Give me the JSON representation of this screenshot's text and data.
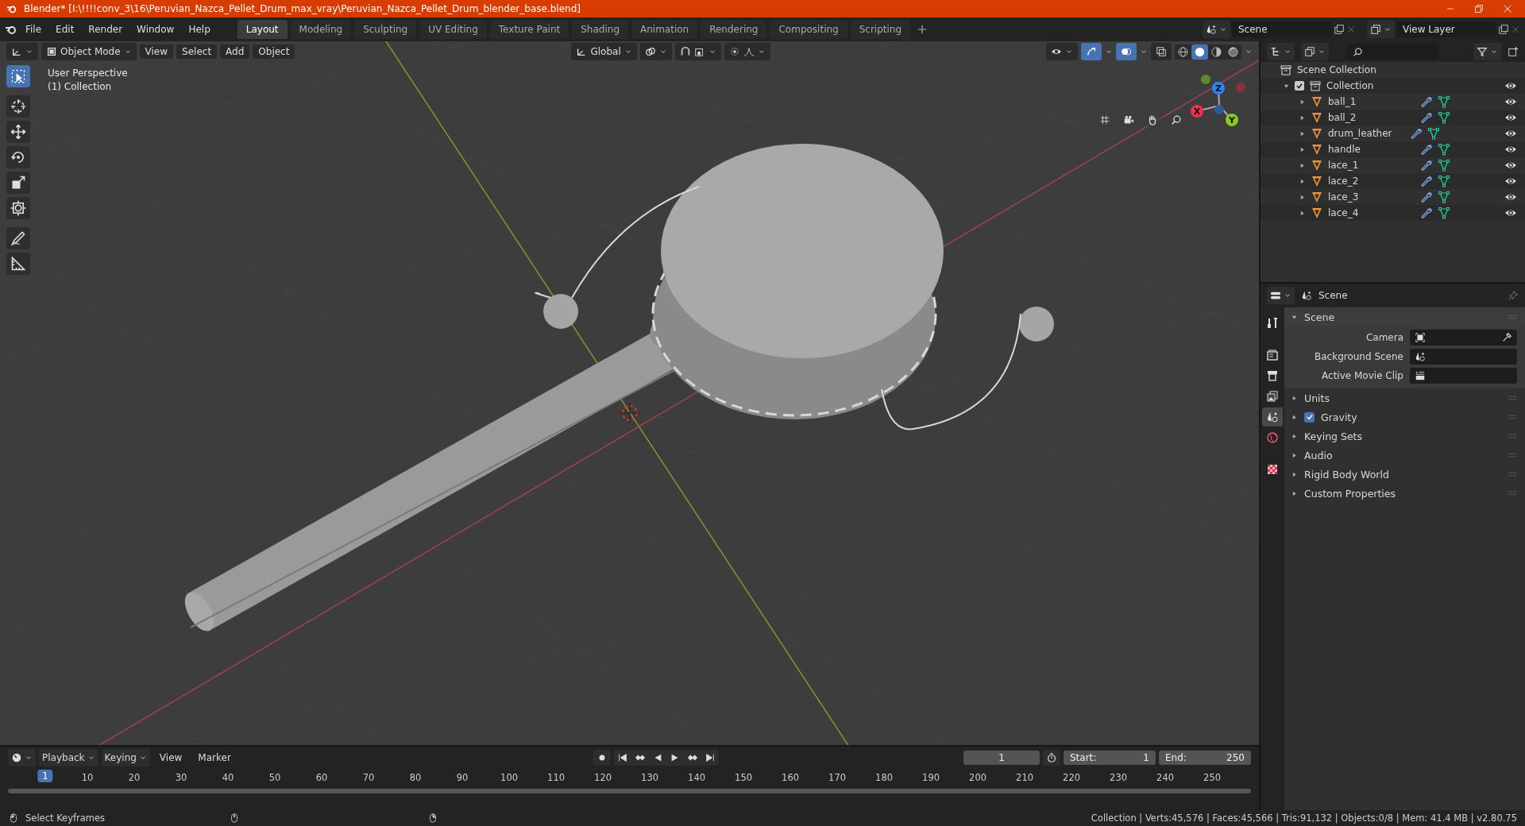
{
  "window": {
    "title": "Blender* [I:\\!!!!conv_3\\16\\Peruvian_Nazca_Pellet_Drum_max_vray\\Peruvian_Nazca_Pellet_Drum_blender_base.blend]"
  },
  "menu": [
    "File",
    "Edit",
    "Render",
    "Window",
    "Help"
  ],
  "workspace_tabs": [
    {
      "label": "Layout",
      "selected": true
    },
    {
      "label": "Modeling",
      "selected": false
    },
    {
      "label": "Sculpting",
      "selected": false
    },
    {
      "label": "UV Editing",
      "selected": false
    },
    {
      "label": "Texture Paint",
      "selected": false
    },
    {
      "label": "Shading",
      "selected": false
    },
    {
      "label": "Animation",
      "selected": false
    },
    {
      "label": "Rendering",
      "selected": false
    },
    {
      "label": "Compositing",
      "selected": false
    },
    {
      "label": "Scripting",
      "selected": false
    }
  ],
  "scene_field": {
    "value": "Scene"
  },
  "view_layer_field": {
    "value": "View Layer"
  },
  "viewport": {
    "mode": "Object Mode",
    "menus": [
      "View",
      "Select",
      "Add",
      "Object"
    ],
    "orientation": "Global",
    "overlay_text": [
      "User Perspective",
      "(1) Collection"
    ],
    "shading": [
      {
        "kind": "wireframe",
        "selected": false
      },
      {
        "kind": "solid",
        "selected": true
      },
      {
        "kind": "material",
        "selected": false
      },
      {
        "kind": "rendered",
        "selected": false
      }
    ],
    "tools": [
      {
        "kind": "select",
        "selected": true
      },
      {
        "kind": "cursor",
        "selected": false
      },
      {
        "kind": "move",
        "selected": false
      },
      {
        "kind": "rotate",
        "selected": false
      },
      {
        "kind": "scale",
        "selected": false
      },
      {
        "kind": "transform",
        "selected": false
      },
      {
        "kind": "annotate",
        "selected": false
      },
      {
        "kind": "measure",
        "selected": false
      }
    ],
    "gizmo_axes": [
      "Z",
      "X",
      "Y"
    ]
  },
  "outliner": {
    "root": "Scene Collection",
    "collections": [
      {
        "name": "Collection",
        "checked": true,
        "expanded": true,
        "children": [
          {
            "name": "ball_1"
          },
          {
            "name": "ball_2"
          },
          {
            "name": "drum_leather"
          },
          {
            "name": "handle"
          },
          {
            "name": "lace_1"
          },
          {
            "name": "lace_2"
          },
          {
            "name": "lace_3"
          },
          {
            "name": "lace_4"
          }
        ]
      }
    ]
  },
  "properties": {
    "context": "Scene",
    "tabs": [
      {
        "kind": "tool",
        "selected": false
      },
      {
        "kind": "render",
        "selected": false
      },
      {
        "kind": "output",
        "selected": false
      },
      {
        "kind": "view_layer",
        "selected": false
      },
      {
        "kind": "scene",
        "selected": true
      },
      {
        "kind": "world",
        "selected": false
      },
      {
        "kind": "texture",
        "selected": false
      }
    ],
    "panels": [
      {
        "title": "Scene",
        "expanded": true,
        "fields": [
          {
            "label": "Camera",
            "kind": "camera"
          },
          {
            "label": "Background Scene",
            "kind": "scene"
          },
          {
            "label": "Active Movie Clip",
            "kind": "clip"
          }
        ]
      },
      {
        "title": "Units",
        "expanded": false
      },
      {
        "title": "Gravity",
        "expanded": false,
        "kind": "checkbox",
        "checked": true
      },
      {
        "title": "Keying Sets",
        "expanded": false
      },
      {
        "title": "Audio",
        "expanded": false
      },
      {
        "title": "Rigid Body World",
        "expanded": false
      },
      {
        "title": "Custom Properties",
        "expanded": false
      }
    ]
  },
  "timeline": {
    "menus": [
      "Playback",
      "Keying",
      "View",
      "Marker"
    ],
    "current_frame": "1",
    "start": {
      "label": "Start:",
      "value": "1"
    },
    "end": {
      "label": "End:",
      "value": "250"
    },
    "ruler": {
      "current": "1",
      "ticks": [
        "10",
        "20",
        "30",
        "40",
        "50",
        "60",
        "70",
        "80",
        "90",
        "100",
        "110",
        "120",
        "130",
        "140",
        "150",
        "160",
        "170",
        "180",
        "190",
        "200",
        "210",
        "220",
        "230",
        "240",
        "250"
      ]
    }
  },
  "status_bar": {
    "hint": "Select Keyframes",
    "stats": "Collection | Verts:45,576 | Faces:45,566 | Tris:91,132 | Objects:0/8 | Mem: 41.4 MB | v2.80.75"
  }
}
